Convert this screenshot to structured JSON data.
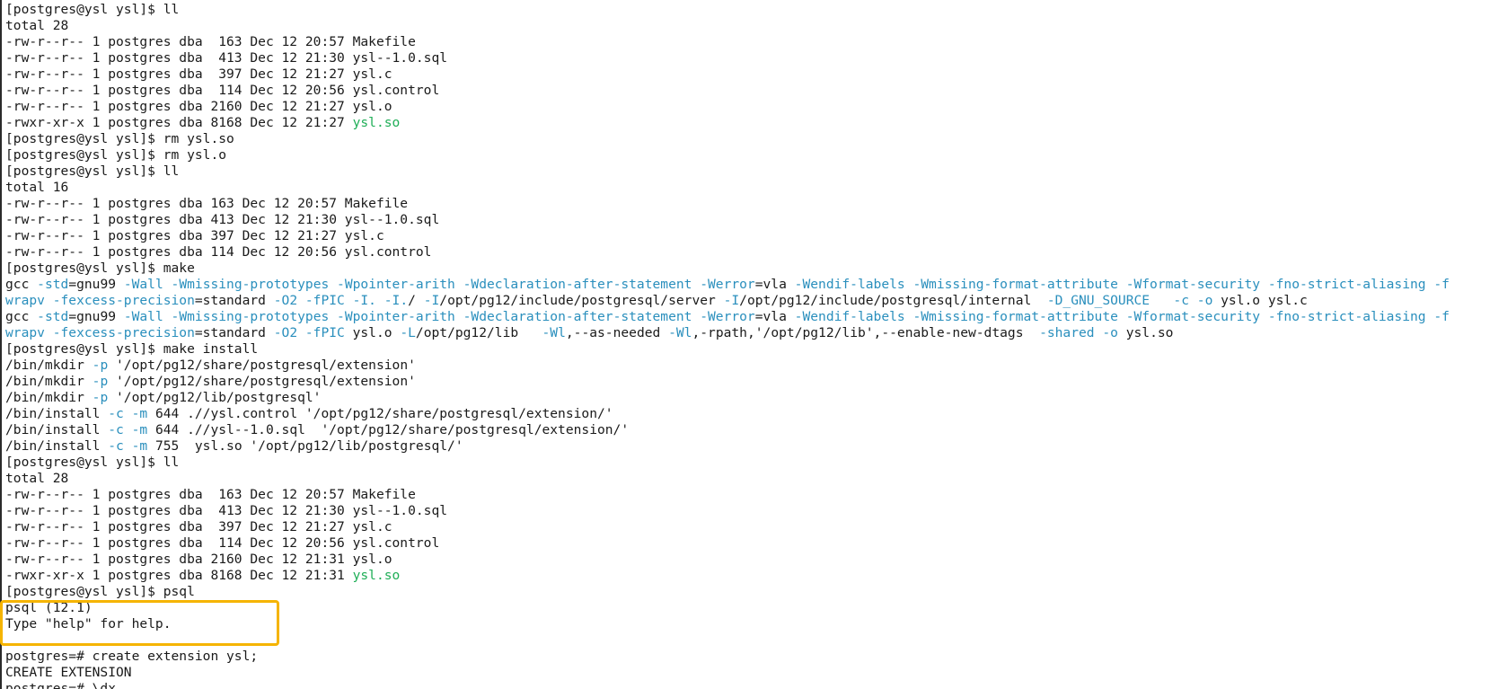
{
  "terminal": {
    "lines": [
      {
        "segments": [
          {
            "text": "[postgres@ysl ysl]$ ll",
            "style": "plain"
          }
        ]
      },
      {
        "segments": [
          {
            "text": "total 28",
            "style": "plain"
          }
        ]
      },
      {
        "segments": [
          {
            "text": "-rw-r--r-- 1 postgres dba  163 Dec 12 20:57 Makefile",
            "style": "plain"
          }
        ]
      },
      {
        "segments": [
          {
            "text": "-rw-r--r-- 1 postgres dba  413 Dec 12 21:30 ysl--1.0.sql",
            "style": "plain"
          }
        ]
      },
      {
        "segments": [
          {
            "text": "-rw-r--r-- 1 postgres dba  397 Dec 12 21:27 ysl.c",
            "style": "plain"
          }
        ]
      },
      {
        "segments": [
          {
            "text": "-rw-r--r-- 1 postgres dba  114 Dec 12 20:56 ysl.control",
            "style": "plain"
          }
        ]
      },
      {
        "segments": [
          {
            "text": "-rw-r--r-- 1 postgres dba 2160 Dec 12 21:27 ysl.o",
            "style": "plain"
          }
        ]
      },
      {
        "segments": [
          {
            "text": "-rwxr-xr-x 1 postgres dba 8168 Dec 12 21:27 ",
            "style": "plain"
          },
          {
            "text": "ysl.so",
            "style": "exe"
          }
        ]
      },
      {
        "segments": [
          {
            "text": "[postgres@ysl ysl]$ rm ysl.so",
            "style": "plain"
          }
        ]
      },
      {
        "segments": [
          {
            "text": "[postgres@ysl ysl]$ rm ysl.o",
            "style": "plain"
          }
        ]
      },
      {
        "segments": [
          {
            "text": "[postgres@ysl ysl]$ ll",
            "style": "plain"
          }
        ]
      },
      {
        "segments": [
          {
            "text": "total 16",
            "style": "plain"
          }
        ]
      },
      {
        "segments": [
          {
            "text": "-rw-r--r-- 1 postgres dba 163 Dec 12 20:57 Makefile",
            "style": "plain"
          }
        ]
      },
      {
        "segments": [
          {
            "text": "-rw-r--r-- 1 postgres dba 413 Dec 12 21:30 ysl--1.0.sql",
            "style": "plain"
          }
        ]
      },
      {
        "segments": [
          {
            "text": "-rw-r--r-- 1 postgres dba 397 Dec 12 21:27 ysl.c",
            "style": "plain"
          }
        ]
      },
      {
        "segments": [
          {
            "text": "-rw-r--r-- 1 postgres dba 114 Dec 12 20:56 ysl.control",
            "style": "plain"
          }
        ]
      },
      {
        "segments": [
          {
            "text": "[postgres@ysl ysl]$ make",
            "style": "plain"
          }
        ]
      },
      {
        "segments": [
          {
            "text": "gcc ",
            "style": "plain"
          },
          {
            "text": "-std",
            "style": "opt"
          },
          {
            "text": "=gnu99 ",
            "style": "plain"
          },
          {
            "text": "-Wall -Wmissing-prototypes -Wpointer-arith -Wdeclaration-after-statement -Werror",
            "style": "opt"
          },
          {
            "text": "=vla ",
            "style": "plain"
          },
          {
            "text": "-Wendif-labels -Wmissing-format-attribute -Wformat-security -fno-strict-aliasing -f",
            "style": "opt"
          }
        ]
      },
      {
        "segments": [
          {
            "text": "wrapv -fexcess-precision",
            "style": "opt"
          },
          {
            "text": "=standard ",
            "style": "plain"
          },
          {
            "text": "-O2 -fPIC -I. -I.",
            "style": "opt"
          },
          {
            "text": "/ ",
            "style": "plain"
          },
          {
            "text": "-I",
            "style": "opt"
          },
          {
            "text": "/opt/pg12/include/postgresql/server ",
            "style": "plain"
          },
          {
            "text": "-I",
            "style": "opt"
          },
          {
            "text": "/opt/pg12/include/postgresql/internal  ",
            "style": "plain"
          },
          {
            "text": "-D_GNU_SOURCE   -c -o",
            "style": "opt"
          },
          {
            "text": " ysl.o ysl.c",
            "style": "plain"
          }
        ]
      },
      {
        "segments": [
          {
            "text": "gcc ",
            "style": "plain"
          },
          {
            "text": "-std",
            "style": "opt"
          },
          {
            "text": "=gnu99 ",
            "style": "plain"
          },
          {
            "text": "-Wall -Wmissing-prototypes -Wpointer-arith -Wdeclaration-after-statement -Werror",
            "style": "opt"
          },
          {
            "text": "=vla ",
            "style": "plain"
          },
          {
            "text": "-Wendif-labels -Wmissing-format-attribute -Wformat-security -fno-strict-aliasing -f",
            "style": "opt"
          }
        ]
      },
      {
        "segments": [
          {
            "text": "wrapv -fexcess-precision",
            "style": "opt"
          },
          {
            "text": "=standard ",
            "style": "plain"
          },
          {
            "text": "-O2 -fPIC",
            "style": "opt"
          },
          {
            "text": " ysl.o ",
            "style": "plain"
          },
          {
            "text": "-L",
            "style": "opt"
          },
          {
            "text": "/opt/pg12/lib   ",
            "style": "plain"
          },
          {
            "text": "-Wl",
            "style": "opt"
          },
          {
            "text": ",--as-needed ",
            "style": "plain"
          },
          {
            "text": "-Wl",
            "style": "opt"
          },
          {
            "text": ",-rpath,'/opt/pg12/lib',--enable-new-dtags  ",
            "style": "plain"
          },
          {
            "text": "-shared -o",
            "style": "opt"
          },
          {
            "text": " ysl.so",
            "style": "plain"
          }
        ]
      },
      {
        "segments": [
          {
            "text": "[postgres@ysl ysl]$ make install",
            "style": "plain"
          }
        ]
      },
      {
        "segments": [
          {
            "text": "/bin/mkdir ",
            "style": "plain"
          },
          {
            "text": "-p",
            "style": "opt"
          },
          {
            "text": " '/opt/pg12/share/postgresql/extension'",
            "style": "plain"
          }
        ]
      },
      {
        "segments": [
          {
            "text": "/bin/mkdir ",
            "style": "plain"
          },
          {
            "text": "-p",
            "style": "opt"
          },
          {
            "text": " '/opt/pg12/share/postgresql/extension'",
            "style": "plain"
          }
        ]
      },
      {
        "segments": [
          {
            "text": "/bin/mkdir ",
            "style": "plain"
          },
          {
            "text": "-p",
            "style": "opt"
          },
          {
            "text": " '/opt/pg12/lib/postgresql'",
            "style": "plain"
          }
        ]
      },
      {
        "segments": [
          {
            "text": "/bin/install ",
            "style": "plain"
          },
          {
            "text": "-c -m",
            "style": "opt"
          },
          {
            "text": " 644 .//ysl.control '/opt/pg12/share/postgresql/extension/'",
            "style": "plain"
          }
        ]
      },
      {
        "segments": [
          {
            "text": "/bin/install ",
            "style": "plain"
          },
          {
            "text": "-c -m",
            "style": "opt"
          },
          {
            "text": " 644 .//ysl--1.0.sql  '/opt/pg12/share/postgresql/extension/'",
            "style": "plain"
          }
        ]
      },
      {
        "segments": [
          {
            "text": "/bin/install ",
            "style": "plain"
          },
          {
            "text": "-c -m",
            "style": "opt"
          },
          {
            "text": " 755  ysl.so '/opt/pg12/lib/postgresql/'",
            "style": "plain"
          }
        ]
      },
      {
        "segments": [
          {
            "text": "[postgres@ysl ysl]$ ll",
            "style": "plain"
          }
        ]
      },
      {
        "segments": [
          {
            "text": "total 28",
            "style": "plain"
          }
        ]
      },
      {
        "segments": [
          {
            "text": "-rw-r--r-- 1 postgres dba  163 Dec 12 20:57 Makefile",
            "style": "plain"
          }
        ]
      },
      {
        "segments": [
          {
            "text": "-rw-r--r-- 1 postgres dba  413 Dec 12 21:30 ysl--1.0.sql",
            "style": "plain"
          }
        ]
      },
      {
        "segments": [
          {
            "text": "-rw-r--r-- 1 postgres dba  397 Dec 12 21:27 ysl.c",
            "style": "plain"
          }
        ]
      },
      {
        "segments": [
          {
            "text": "-rw-r--r-- 1 postgres dba  114 Dec 12 20:56 ysl.control",
            "style": "plain"
          }
        ]
      },
      {
        "segments": [
          {
            "text": "-rw-r--r-- 1 postgres dba 2160 Dec 12 21:31 ysl.o",
            "style": "plain"
          }
        ]
      },
      {
        "segments": [
          {
            "text": "-rwxr-xr-x 1 postgres dba 8168 Dec 12 21:31 ",
            "style": "plain"
          },
          {
            "text": "ysl.so",
            "style": "exe"
          }
        ]
      },
      {
        "segments": [
          {
            "text": "[postgres@ysl ysl]$ psql",
            "style": "plain"
          }
        ]
      },
      {
        "segments": [
          {
            "text": "psql (12.1)",
            "style": "plain"
          }
        ]
      },
      {
        "segments": [
          {
            "text": "Type \"help\" for help.",
            "style": "plain"
          }
        ]
      },
      {
        "segments": [
          {
            "text": "",
            "style": "plain"
          }
        ]
      },
      {
        "segments": [
          {
            "text": "postgres=# create extension ysl;",
            "style": "plain"
          }
        ]
      },
      {
        "segments": [
          {
            "text": "CREATE EXTENSION",
            "style": "plain"
          }
        ]
      },
      {
        "segments": [
          {
            "text": "postgres=# \\dx",
            "style": "plain"
          }
        ]
      }
    ]
  },
  "colors": {
    "background": "#ffffff",
    "text": "#1a1a1a",
    "option_flag": "#2a8fbd",
    "executable": "#1fae57",
    "highlight_border": "#f5b400"
  }
}
